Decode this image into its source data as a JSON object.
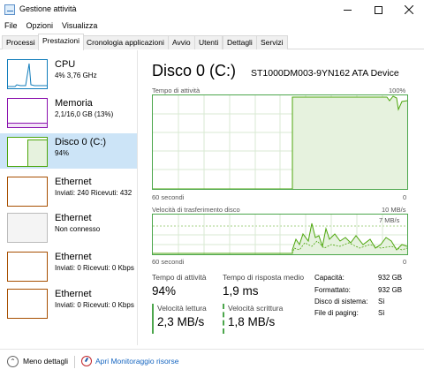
{
  "window": {
    "title": "Gestione attività",
    "controls": {
      "minimize": "minimize-icon",
      "maximize": "maximize-icon",
      "close": "close-icon"
    }
  },
  "menu": [
    "File",
    "Opzioni",
    "Visualizza"
  ],
  "tabs": [
    {
      "label": "Processi",
      "active": false
    },
    {
      "label": "Prestazioni",
      "active": true
    },
    {
      "label": "Cronologia applicazioni",
      "active": false
    },
    {
      "label": "Avvio",
      "active": false
    },
    {
      "label": "Utenti",
      "active": false
    },
    {
      "label": "Dettagli",
      "active": false
    },
    {
      "label": "Servizi",
      "active": false
    }
  ],
  "resources": [
    {
      "name": "CPU",
      "sub": "4%  3,76 GHz",
      "color": "#117dbb"
    },
    {
      "name": "Memoria",
      "sub": "2,1/16,0 GB (13%)",
      "color": "#8b12ae"
    },
    {
      "name": "Disco 0 (C:)",
      "sub": "94%",
      "color": "#4da60c",
      "selected": true
    },
    {
      "name": "Ethernet",
      "sub": "Inviati: 240  Ricevuti: 432",
      "color": "#a74f01"
    },
    {
      "name": "Ethernet",
      "sub": "Non connesso",
      "color": "#a74f01"
    },
    {
      "name": "Ethernet",
      "sub": "Inviati: 0  Ricevuti: 0 Kbps",
      "color": "#a74f01"
    },
    {
      "name": "Ethernet",
      "sub": "Inviati: 0  Ricevuti: 0 Kbps",
      "color": "#a74f01"
    }
  ],
  "main": {
    "title": "Disco 0 (C:)",
    "device": "ST1000DM003-9YN162 ATA Device",
    "graph1": {
      "label": "Tempo di attività",
      "max": "100%",
      "time": "60 secondi",
      "min": "0"
    },
    "graph2": {
      "label": "Velocità di trasferimento disco",
      "max": "10 MB/s",
      "mid": "7 MB/s",
      "time": "60 secondi",
      "min": "0"
    },
    "stats": {
      "active_time_label": "Tempo di attività",
      "active_time_value": "94%",
      "response_label": "Tempo di risposta medio",
      "response_value": "1,9 ms",
      "read_label": "Velocità lettura",
      "read_value": "2,3 MB/s",
      "write_label": "Velocità scrittura",
      "write_value": "1,8 MB/s"
    },
    "properties": [
      {
        "key": "Capacità:",
        "value": "932 GB"
      },
      {
        "key": "Formattato:",
        "value": "932 GB"
      },
      {
        "key": "Disco di sistema:",
        "value": "Sì"
      },
      {
        "key": "File di paging:",
        "value": "Sì"
      }
    ]
  },
  "bottom": {
    "fewer_details": "Meno dettagli",
    "monitor_link": "Apri Monitoraggio risorse"
  }
}
